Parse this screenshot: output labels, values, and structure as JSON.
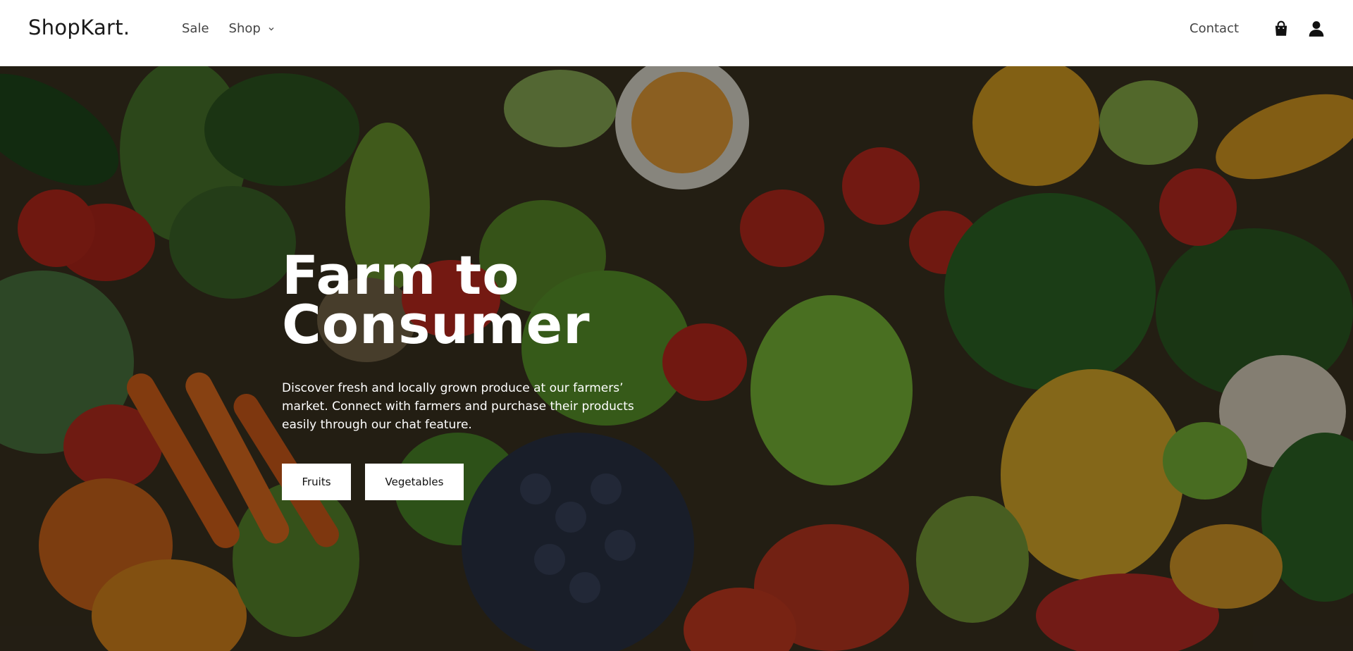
{
  "header": {
    "logo": "ShopKart.",
    "nav": [
      {
        "label": "Sale"
      },
      {
        "label": "Shop"
      }
    ],
    "contact": "Contact",
    "icons": [
      "shopping-bag-icon",
      "user-icon",
      "chevron-down-icon"
    ]
  },
  "hero": {
    "title": "Farm to Consumer",
    "description": "Discover fresh and locally grown produce at our farmers’ market. Connect with farmers and purchase their products easily through our chat feature.",
    "buttons": {
      "fruits": "Fruits",
      "vegetables": "Vegetables"
    }
  }
}
